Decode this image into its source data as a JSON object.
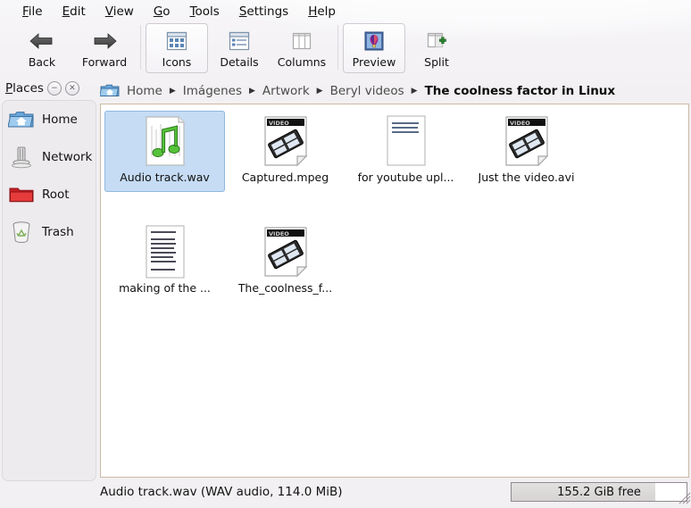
{
  "menubar": {
    "items": [
      {
        "label": "File",
        "mnemonic": "F"
      },
      {
        "label": "Edit",
        "mnemonic": "E"
      },
      {
        "label": "View",
        "mnemonic": "V"
      },
      {
        "label": "Go",
        "mnemonic": "G"
      },
      {
        "label": "Tools",
        "mnemonic": "T"
      },
      {
        "label": "Settings",
        "mnemonic": "S"
      },
      {
        "label": "Help",
        "mnemonic": "H"
      }
    ]
  },
  "toolbar": {
    "buttons": [
      {
        "label": "Back",
        "icon": "arrow-left-icon",
        "active": false
      },
      {
        "label": "Forward",
        "icon": "arrow-right-icon",
        "active": false
      },
      {
        "label": "Icons",
        "icon": "icons-view-icon",
        "active": true
      },
      {
        "label": "Details",
        "icon": "details-view-icon",
        "active": false
      },
      {
        "label": "Columns",
        "icon": "columns-view-icon",
        "active": false
      },
      {
        "label": "Preview",
        "icon": "preview-image-icon",
        "active": true
      },
      {
        "label": "Split",
        "icon": "split-view-icon",
        "active": false
      }
    ]
  },
  "sidebar": {
    "title": "Places",
    "title_mnemonic": "P",
    "minimize_glyph": "−",
    "close_glyph": "✕",
    "items": [
      {
        "label": "Home",
        "icon": "home-folder-icon"
      },
      {
        "label": "Network",
        "icon": "network-icon"
      },
      {
        "label": "Root",
        "icon": "root-folder-icon"
      },
      {
        "label": "Trash",
        "icon": "trash-icon"
      }
    ]
  },
  "breadcrumb": {
    "home_icon": "home-icon",
    "separator": "▶",
    "items": [
      {
        "label": "Home",
        "current": false
      },
      {
        "label": "Imágenes",
        "current": false
      },
      {
        "label": "Artwork",
        "current": false
      },
      {
        "label": "Beryl videos",
        "current": false
      },
      {
        "label": "The coolness factor in Linux",
        "current": true
      }
    ]
  },
  "files": [
    {
      "name": "Audio track.wav",
      "kind": "audio",
      "selected": true
    },
    {
      "name": "Captured.mpeg",
      "kind": "video",
      "selected": false
    },
    {
      "name": "for youtube upl...",
      "kind": "text-paragraph",
      "selected": false
    },
    {
      "name": "Just the video.avi",
      "kind": "video",
      "selected": false
    },
    {
      "name": "making of the ...",
      "kind": "text-list",
      "selected": false
    },
    {
      "name": "The_coolness_f...",
      "kind": "video",
      "selected": false
    }
  ],
  "video_thumb_label": "VIDEO",
  "statusbar": {
    "text": "Audio track.wav (WAV audio, 114.0 MiB)",
    "free_space": "155.2 GiB free",
    "free_fill_percent": 82
  },
  "colors": {
    "selection": "#c5dcf4",
    "view_border": "#cbb9a4",
    "background": "#f2f0f2",
    "sidebar": "#eeebee"
  }
}
